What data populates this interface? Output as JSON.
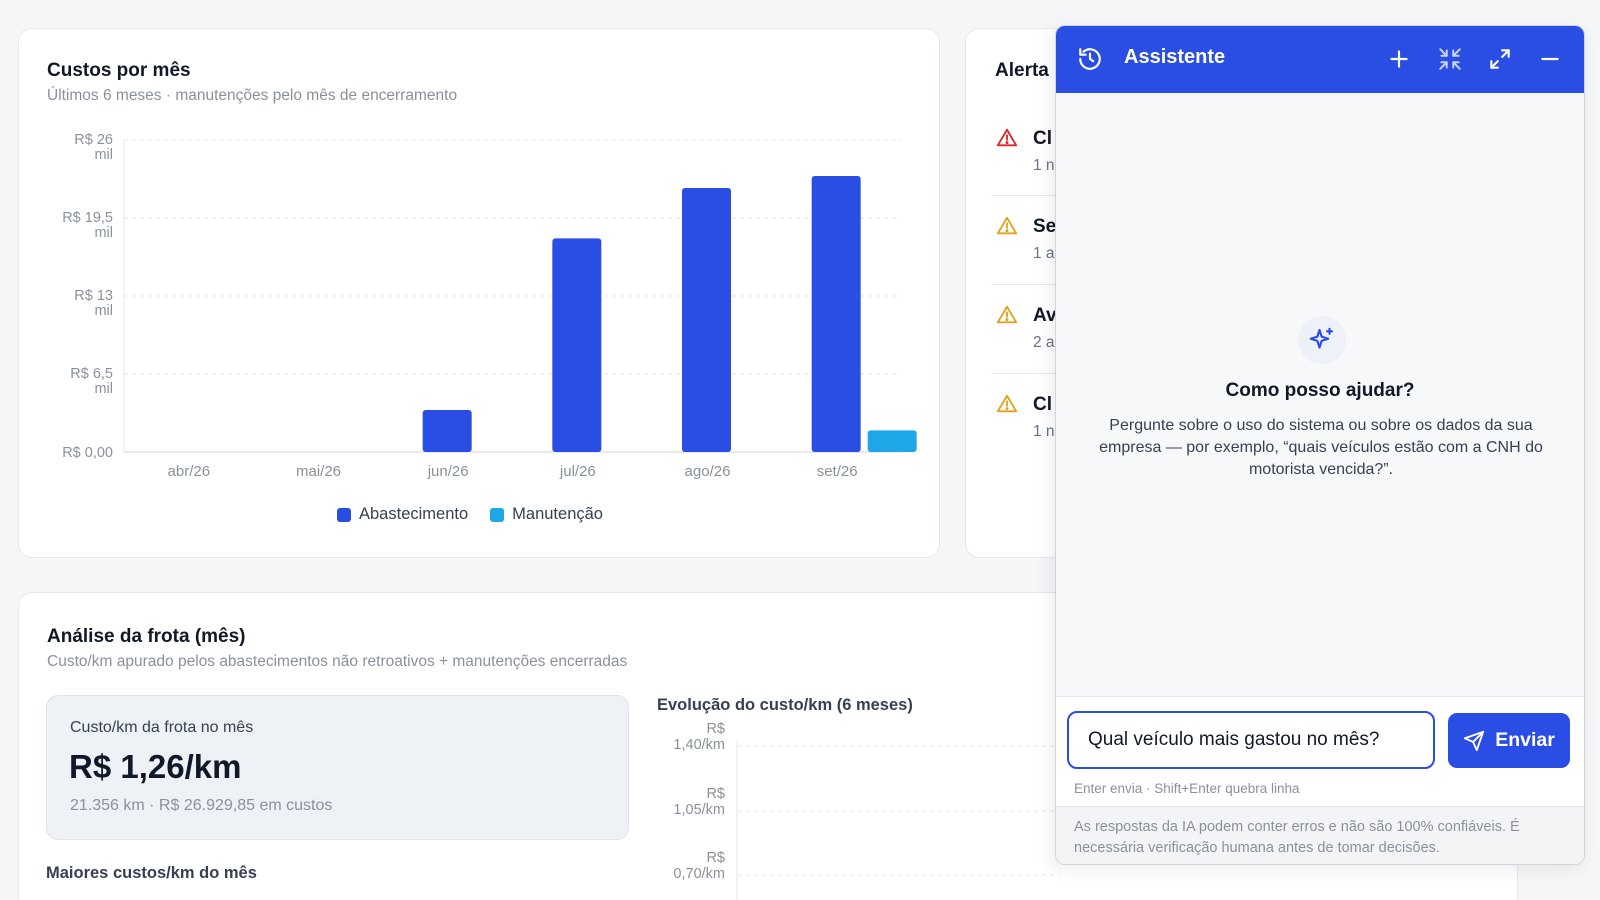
{
  "costs_card": {
    "title": "Custos por mês",
    "subtitle": "Últimos 6 meses · manutenções pelo mês de encerramento"
  },
  "chart_data": {
    "type": "bar",
    "categories": [
      "abr/26",
      "mai/26",
      "jun/26",
      "jul/26",
      "ago/26",
      "set/26"
    ],
    "series": [
      {
        "name": "Abastecimento",
        "color": "#2a4ee4",
        "values": [
          0,
          0,
          3500,
          17800,
          22000,
          23000
        ]
      },
      {
        "name": "Manutenção",
        "color": "#1ea7e8",
        "values": [
          0,
          0,
          0,
          0,
          0,
          1800
        ]
      }
    ],
    "ylim": [
      0,
      26000
    ],
    "yticks": [
      {
        "value": 26000,
        "line1": "R$ 26",
        "line2": "mil"
      },
      {
        "value": 19500,
        "line1": "R$ 19,5",
        "line2": "mil"
      },
      {
        "value": 13000,
        "line1": "R$ 13",
        "line2": "mil"
      },
      {
        "value": 6500,
        "line1": "R$ 6,5",
        "line2": "mil"
      },
      {
        "value": 0,
        "line1": "R$ 0,00",
        "line2": ""
      }
    ],
    "grid": true,
    "legend": "bottom-center"
  },
  "alerts": {
    "title": "Alerta",
    "items": [
      {
        "title": "Cl",
        "meta": "1 n",
        "severity": "danger"
      },
      {
        "title": "Se",
        "meta": "1 a",
        "severity": "warning"
      },
      {
        "title": "Av",
        "meta": "2 a",
        "severity": "warning"
      },
      {
        "title": "Cl",
        "meta": "1 n",
        "severity": "warning"
      }
    ]
  },
  "fleet": {
    "title": "Análise da frota (mês)",
    "subtitle": "Custo/km apurado pelos abastecimentos não retroativos + manutenções encerradas",
    "kpi_label": "Custo/km da frota no mês",
    "kpi_value": "R$ 1,26/km",
    "kpi_foot": "21.356 km · R$ 26.929,85 em custos",
    "top_costs_label": "Maiores custos/km do mês",
    "evolution_label": "Evolução do custo/km (6 meses)",
    "evolution_ticks": [
      {
        "line1": "R$",
        "line2": "1,40/km"
      },
      {
        "line1": "R$",
        "line2": "1,05/km"
      },
      {
        "line1": "R$",
        "line2": "0,70/km"
      }
    ]
  },
  "assistant": {
    "title": "Assistente",
    "empty_title": "Como posso ajudar?",
    "empty_text": "Pergunte sobre o uso do sistema ou sobre os dados da sua empresa — por exemplo, “quais veículos estão com a CNH do motorista vencida?”.",
    "input_value": "Qual veículo mais gastou no mês?",
    "send_label": "Enviar",
    "hint": "Enter envia · Shift+Enter quebra linha",
    "disclaimer": "As respostas da IA podem conter erros e não são 100% confiáveis. É necessária verificação humana antes de tomar decisões.",
    "header_icons": [
      "history-icon",
      "plus-icon",
      "collapse-icon",
      "expand-icon",
      "minimize-icon"
    ]
  },
  "colors": {
    "primary": "#2a4ee4",
    "secondary": "#1ea7e8",
    "danger": "#dc2626",
    "warning": "#e0a21b"
  }
}
